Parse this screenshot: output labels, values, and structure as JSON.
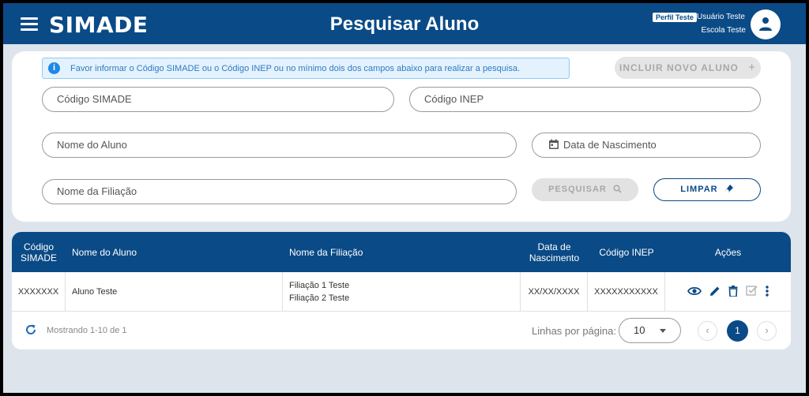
{
  "header": {
    "logo": "SIMADE",
    "title": "Pesquisar Aluno",
    "profile_badge": "Perfil Teste",
    "user_name": "Usuário Teste",
    "school_name": "Escola Teste",
    "bg_color": "#0a4a86"
  },
  "search": {
    "info_message": "Favor informar o Código SIMADE ou o Código INEP ou no mínimo dois dos campos abaixo para realizar a pesquisa.",
    "new_student_label": "INCLUIR NOVO ALUNO",
    "new_student_icon": "+",
    "fields": {
      "codigo_simade": "Código SIMADE",
      "codigo_inep": "Código INEP",
      "nome_aluno": "Nome do Aluno",
      "data_nascimento": "Data de Nascimento",
      "nome_filiacao": "Nome da Filiação"
    },
    "search_label": "PESQUISAR",
    "clear_label": "LIMPAR"
  },
  "table": {
    "headers": {
      "codigo_simade": [
        "Código",
        "SIMADE"
      ],
      "nome_aluno": "Nome do Aluno",
      "nome_filiacao": "Nome da Filiação",
      "data_nascimento": [
        "Data de",
        "Nascimento"
      ],
      "codigo_inep": "Código INEP",
      "acoes": "Ações"
    },
    "rows": [
      {
        "codigo_simade": "XXXXXXX",
        "nome_aluno": "Aluno Teste",
        "filiacao_1": "Filiação 1 Teste",
        "filiacao_2": "Filiação 2 Teste",
        "data_nascimento": "XX/XX/XXXX",
        "codigo_inep": "XXXXXXXXXXX",
        "actions": [
          "eye-icon",
          "pencil-icon",
          "trash-icon",
          "checkbox-icon",
          "more-vert-icon"
        ]
      }
    ],
    "footer": {
      "showing": "Mostrando 1-10 de 1",
      "rows_per_page_label": "Linhas por página:",
      "rows_per_page_value": "10",
      "current_page": "1",
      "prev_icon": "‹",
      "next_icon": "›"
    }
  }
}
